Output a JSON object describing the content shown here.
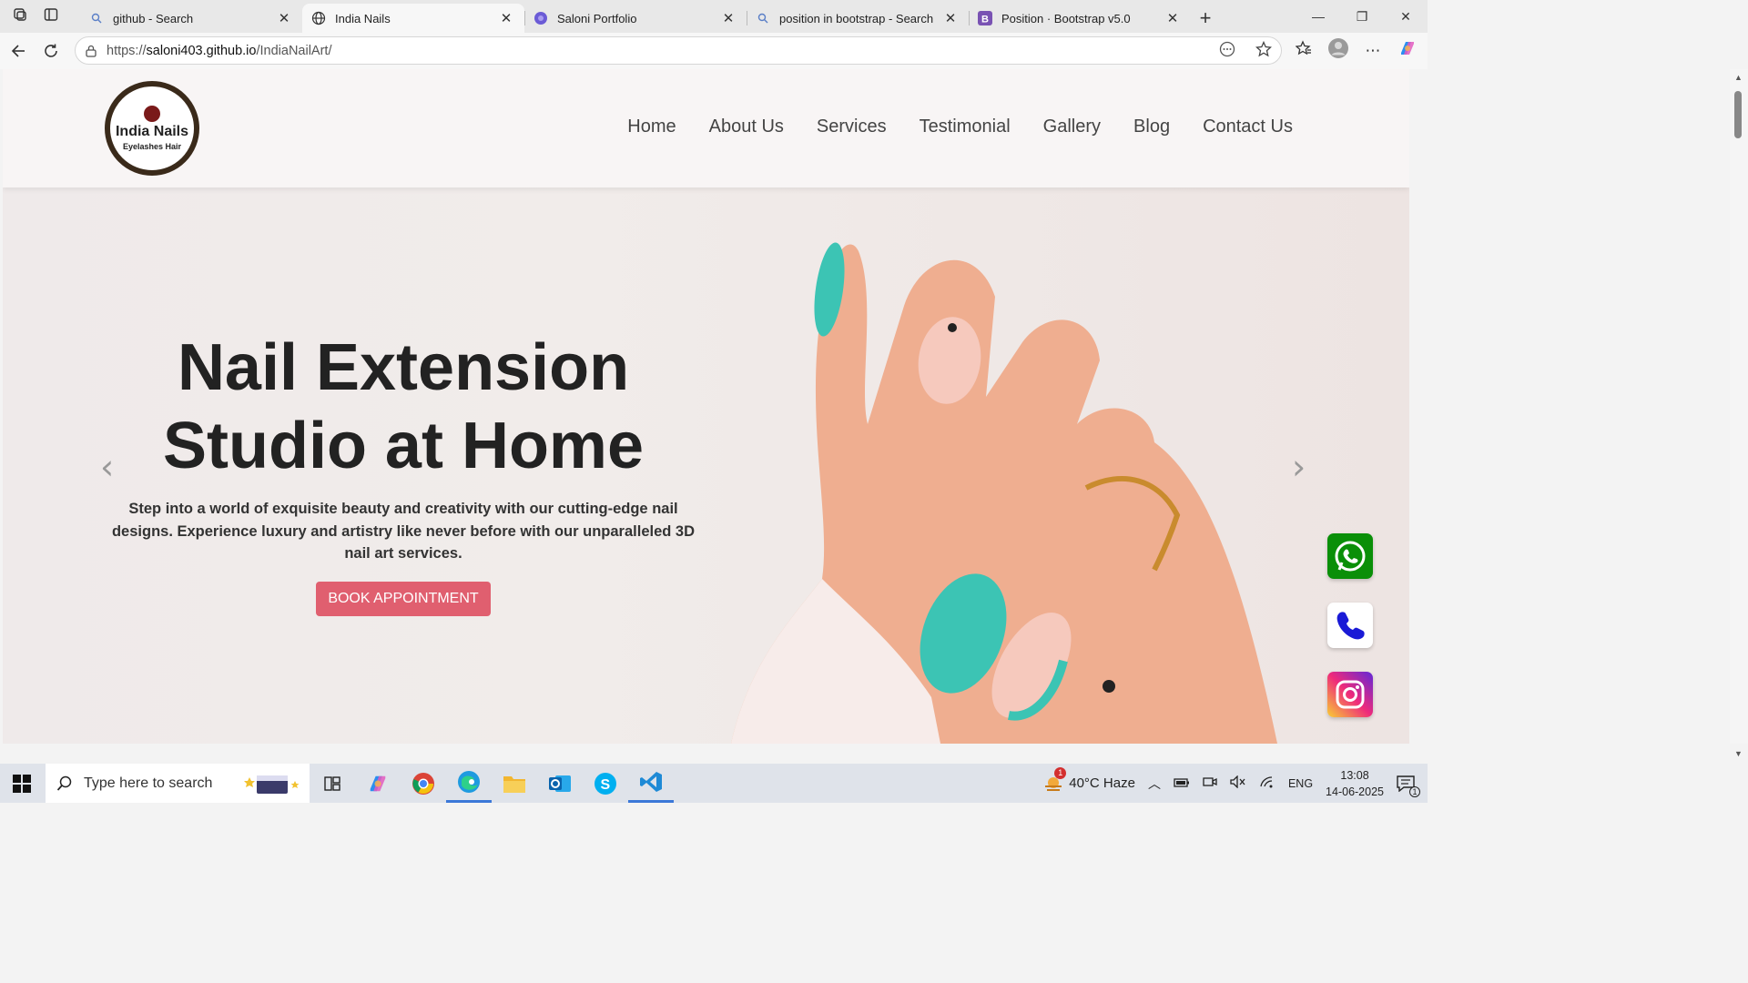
{
  "browser": {
    "tabs": [
      {
        "title": "github - Search",
        "icon": "search-icon",
        "active": false
      },
      {
        "title": "India Nails",
        "icon": "globe-icon",
        "active": true
      },
      {
        "title": "Saloni Portfolio",
        "icon": "site-icon",
        "active": false
      },
      {
        "title": "position in bootstrap - Search",
        "icon": "search-icon",
        "active": false
      },
      {
        "title": "Position · Bootstrap v5.0",
        "icon": "bootstrap-icon",
        "active": false
      }
    ],
    "url_prefix": "https://",
    "url_host": "saloni403.github.io",
    "url_path": "/IndiaNailArt/"
  },
  "site": {
    "logo_line1": "India Nails",
    "logo_line2": "Eyelashes Hair",
    "nav": [
      "Home",
      "About Us",
      "Services",
      "Testimonial",
      "Gallery",
      "Blog",
      "Contact Us"
    ],
    "hero_title_1": "Nail Extension",
    "hero_title_2": "Studio at Home",
    "hero_text": "Step into a world of exquisite beauty and creativity with our cutting-edge nail designs. Experience luxury and artistry like never before with our unparalleled 3D nail art services.",
    "cta": "BOOK APPOINTMENT",
    "social": [
      {
        "name": "whatsapp-icon",
        "color": "#0a8f08"
      },
      {
        "name": "phone-icon",
        "color": "#ffffff"
      },
      {
        "name": "instagram-icon",
        "color": "#d6249f"
      }
    ]
  },
  "taskbar": {
    "search_placeholder": "Type here to search",
    "weather": "40°C  Haze",
    "language": "ENG",
    "time": "13:08",
    "date": "14-06-2025",
    "weather_badge": "1",
    "notif_count": "1"
  }
}
